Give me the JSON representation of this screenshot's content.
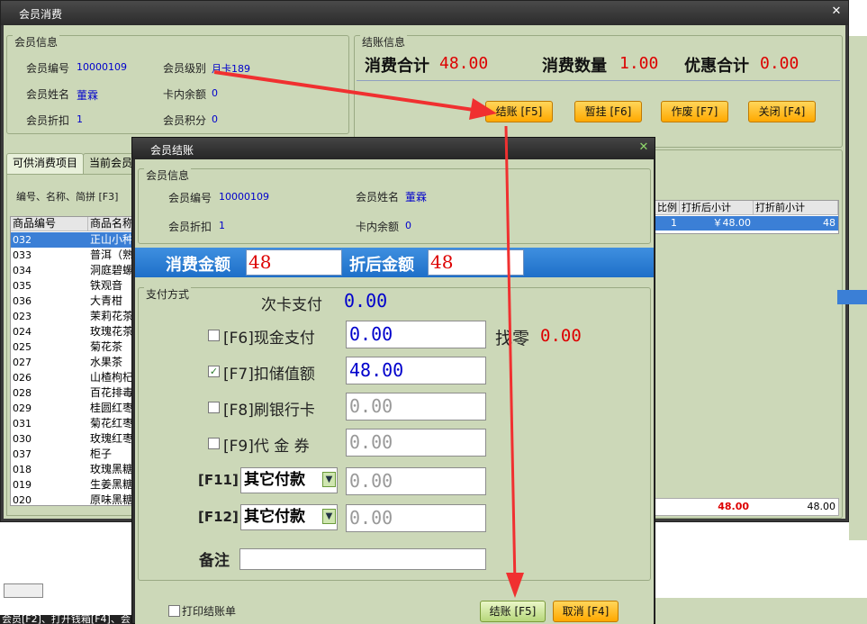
{
  "main_window": {
    "title": "会员消费",
    "close_glyph": "✕",
    "member_info": {
      "title": "会员信息",
      "member_no_label": "会员编号",
      "member_no": "10000109",
      "member_level_label": "会员级别",
      "member_level": "月卡189",
      "member_name_label": "会员姓名",
      "member_name": "董霖",
      "card_balance_label": "卡内余额",
      "card_balance": "0",
      "member_discount_label": "会员折扣",
      "member_discount": "1",
      "member_points_label": "会员积分",
      "member_points": "0"
    },
    "checkout_info": {
      "title": "结账信息",
      "total_label": "消费合计",
      "total": "48.00",
      "qty_label": "消费数量",
      "qty": "1.00",
      "discount_label": "优惠合计",
      "discount": "0.00",
      "buttons": {
        "checkout": "结账 [F5]",
        "hold": "暂挂 [F6]",
        "void": "作废 [F7]",
        "close": "关闭 [F4]"
      }
    },
    "tabs": [
      "可供消费项目",
      "当前会员"
    ],
    "search_label": "编号、名称、简拼 [F3]",
    "product_table": {
      "headers": [
        "商品编号",
        "商品名称"
      ],
      "rows": [
        {
          "code": "032",
          "name": "正山小种"
        },
        {
          "code": "033",
          "name": "普洱（熟"
        },
        {
          "code": "034",
          "name": "洞庭碧螺"
        },
        {
          "code": "035",
          "name": "铁观音"
        },
        {
          "code": "036",
          "name": "大青柑"
        },
        {
          "code": "023",
          "name": "茉莉花茶"
        },
        {
          "code": "024",
          "name": "玫瑰花茶"
        },
        {
          "code": "025",
          "name": "菊花茶"
        },
        {
          "code": "027",
          "name": "水果茶"
        },
        {
          "code": "026",
          "name": "山楂枸杞"
        },
        {
          "code": "028",
          "name": "百花排毒"
        },
        {
          "code": "029",
          "name": "桂圆红枣"
        },
        {
          "code": "031",
          "name": "菊花红枣"
        },
        {
          "code": "030",
          "name": "玫瑰红枣"
        },
        {
          "code": "037",
          "name": "柜子"
        },
        {
          "code": "018",
          "name": "玫瑰黑糖"
        },
        {
          "code": "019",
          "name": "生姜黑糖"
        },
        {
          "code": "020",
          "name": "原味黑糖"
        }
      ]
    },
    "right_table": {
      "headers": [
        "比例",
        "打折后小计",
        "打折前小计"
      ],
      "row": [
        "1",
        "￥48.00",
        "48"
      ],
      "footer": [
        "48.00",
        "48.00"
      ]
    },
    "statusbar_text": "会员[F2]、打开钱箱[F4]、会"
  },
  "dialog": {
    "title": "会员结账",
    "close_glyph": "✕",
    "member_info": {
      "title": "会员信息",
      "member_no_label": "会员编号",
      "member_no": "10000109",
      "member_name_label": "会员姓名",
      "member_name": "董霖",
      "member_discount_label": "会员折扣",
      "member_discount": "1",
      "card_balance_label": "卡内余额",
      "card_balance": "0"
    },
    "amount_label": "消费金额",
    "amount": "48",
    "discounted_label": "折后金额",
    "discounted": "48",
    "payment": {
      "title": "支付方式",
      "times_card_label": "次卡支付",
      "times_card_value": "0.00",
      "cash_label": "[F6]现金支付",
      "cash_value": "0.00",
      "change_label": "找零",
      "change_value": "0.00",
      "stored_label": "[F7]扣储值额",
      "stored_value": "48.00",
      "bank_label": "[F8]刷银行卡",
      "bank_value": "0.00",
      "voucher_label": "[F9]代 金 券",
      "voucher_value": "0.00",
      "other1_key": "[F11]",
      "other1_select": "其它付款",
      "other1_value": "0.00",
      "other2_key": "[F12]",
      "other2_select": "其它付款",
      "other2_value": "0.00",
      "remark_label": "备注",
      "remark_value": ""
    },
    "print_receipt_label": "打印结账单",
    "checkout_button": "结账 [F5]",
    "cancel_button": "取消 [F4]"
  },
  "colors": {
    "panel_bg": "#ccd8b8",
    "accent_red": "#dd0000",
    "value_blue": "#0000cc",
    "amount_bar_blue": "#1e6fc8",
    "arrow_red": "#f03030"
  }
}
